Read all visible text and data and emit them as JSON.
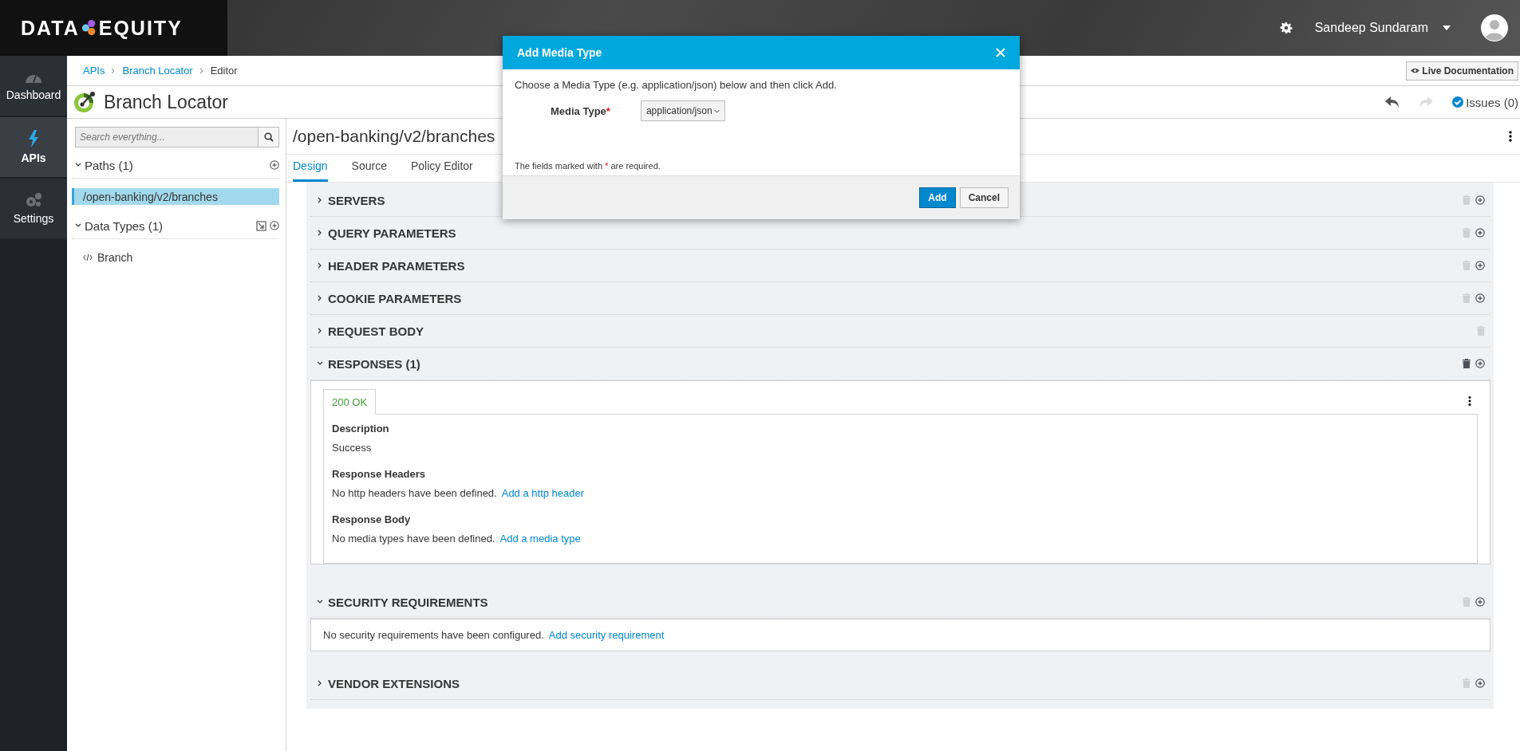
{
  "logo": {
    "left": "DATA",
    "right": "EQUITY"
  },
  "top_bar": {
    "user_name": "Sandeep Sundaram"
  },
  "nav": [
    {
      "kind": "dashboard",
      "label": "Dashboard",
      "selected": false
    },
    {
      "kind": "apis",
      "label": "APIs",
      "selected": true
    },
    {
      "kind": "settings",
      "label": "Settings",
      "selected": false
    }
  ],
  "breadcrumb": [
    {
      "label": "APIs",
      "link": true
    },
    {
      "label": "Branch Locator",
      "link": true
    },
    {
      "label": "Editor",
      "link": false
    }
  ],
  "live_documentation_button": "Live Documentation",
  "api_title": "Branch Locator",
  "undo": {
    "disabled": false
  },
  "redo": {
    "disabled": true
  },
  "issues": "Issues (0)",
  "sidebar": {
    "search": {
      "placeholder": "Search everything..."
    },
    "groups": [
      {
        "heading": "Paths (1)",
        "expanded": true,
        "importable": false,
        "items": [
          {
            "label": "/open-banking/v2/branches",
            "kind": "path",
            "selected": true
          }
        ]
      },
      {
        "heading": "Data Types (1)",
        "expanded": true,
        "importable": true,
        "items": [
          {
            "label": "Branch",
            "kind": "type",
            "selected": false
          }
        ]
      }
    ]
  },
  "path_title": "/open-banking/v2/branches",
  "tabs": [
    {
      "label": "Design",
      "selected": true
    },
    {
      "label": "Source",
      "selected": false
    },
    {
      "label": "Policy Editor",
      "selected": false
    }
  ],
  "sections": [
    {
      "title": "SERVERS",
      "expanded": false,
      "deletable": false,
      "addable": true
    },
    {
      "title": "QUERY PARAMETERS",
      "expanded": false,
      "deletable": false,
      "addable": true
    },
    {
      "title": "HEADER PARAMETERS",
      "expanded": false,
      "deletable": false,
      "addable": true
    },
    {
      "title": "COOKIE PARAMETERS",
      "expanded": false,
      "deletable": false,
      "addable": true
    },
    {
      "title": "REQUEST BODY",
      "expanded": false,
      "deletable": false,
      "addable": false
    },
    {
      "title": "RESPONSES (1)",
      "expanded": true,
      "deletable": true,
      "addable": true,
      "kind": "responses",
      "responses": {
        "tabs": [
          {
            "label": "200 OK",
            "selected": true
          }
        ],
        "fields": [
          {
            "label": "Description",
            "text": "Success"
          },
          {
            "label": "Response Headers",
            "text": "No http headers have been defined.",
            "link": "Add a http header"
          },
          {
            "label": "Response Body",
            "text": "No media types have been defined.",
            "link": "Add a media type"
          }
        ]
      }
    },
    {
      "title": "SECURITY REQUIREMENTS",
      "expanded": true,
      "deletable": false,
      "addable": true,
      "kind": "message",
      "message": "No security requirements have been configured.",
      "link": "Add security requirement"
    },
    {
      "title": "VENDOR EXTENSIONS",
      "expanded": false,
      "deletable": false,
      "addable": true
    }
  ],
  "dialog": {
    "title": "Add Media Type",
    "intro": "Choose a Media Type (e.g. application/json) below and then click Add.",
    "field_label": "Media Type",
    "required_mark": "*",
    "value": "application/json",
    "note_before": "The fields marked with",
    "note_mark": "*",
    "note_after": "are required.",
    "buttons": [
      {
        "label": "Add",
        "kind": "primary"
      },
      {
        "label": "Cancel",
        "kind": "default"
      }
    ]
  }
}
